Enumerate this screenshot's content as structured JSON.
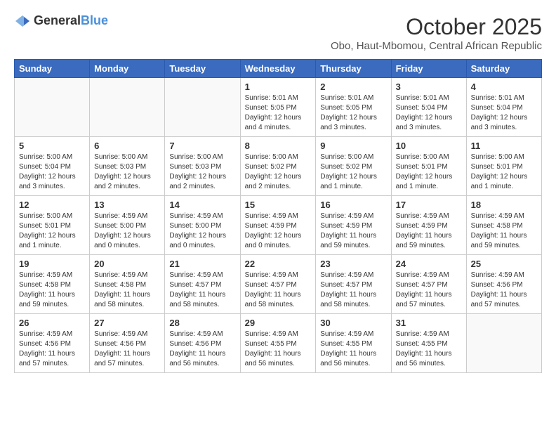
{
  "logo": {
    "general": "General",
    "blue": "Blue"
  },
  "header": {
    "month": "October 2025",
    "location": "Obo, Haut-Mbomou, Central African Republic"
  },
  "days_of_week": [
    "Sunday",
    "Monday",
    "Tuesday",
    "Wednesday",
    "Thursday",
    "Friday",
    "Saturday"
  ],
  "weeks": [
    [
      {
        "day": "",
        "info": ""
      },
      {
        "day": "",
        "info": ""
      },
      {
        "day": "",
        "info": ""
      },
      {
        "day": "1",
        "info": "Sunrise: 5:01 AM\nSunset: 5:05 PM\nDaylight: 12 hours\nand 4 minutes."
      },
      {
        "day": "2",
        "info": "Sunrise: 5:01 AM\nSunset: 5:05 PM\nDaylight: 12 hours\nand 3 minutes."
      },
      {
        "day": "3",
        "info": "Sunrise: 5:01 AM\nSunset: 5:04 PM\nDaylight: 12 hours\nand 3 minutes."
      },
      {
        "day": "4",
        "info": "Sunrise: 5:01 AM\nSunset: 5:04 PM\nDaylight: 12 hours\nand 3 minutes."
      }
    ],
    [
      {
        "day": "5",
        "info": "Sunrise: 5:00 AM\nSunset: 5:04 PM\nDaylight: 12 hours\nand 3 minutes."
      },
      {
        "day": "6",
        "info": "Sunrise: 5:00 AM\nSunset: 5:03 PM\nDaylight: 12 hours\nand 2 minutes."
      },
      {
        "day": "7",
        "info": "Sunrise: 5:00 AM\nSunset: 5:03 PM\nDaylight: 12 hours\nand 2 minutes."
      },
      {
        "day": "8",
        "info": "Sunrise: 5:00 AM\nSunset: 5:02 PM\nDaylight: 12 hours\nand 2 minutes."
      },
      {
        "day": "9",
        "info": "Sunrise: 5:00 AM\nSunset: 5:02 PM\nDaylight: 12 hours\nand 1 minute."
      },
      {
        "day": "10",
        "info": "Sunrise: 5:00 AM\nSunset: 5:01 PM\nDaylight: 12 hours\nand 1 minute."
      },
      {
        "day": "11",
        "info": "Sunrise: 5:00 AM\nSunset: 5:01 PM\nDaylight: 12 hours\nand 1 minute."
      }
    ],
    [
      {
        "day": "12",
        "info": "Sunrise: 5:00 AM\nSunset: 5:01 PM\nDaylight: 12 hours\nand 1 minute."
      },
      {
        "day": "13",
        "info": "Sunrise: 4:59 AM\nSunset: 5:00 PM\nDaylight: 12 hours\nand 0 minutes."
      },
      {
        "day": "14",
        "info": "Sunrise: 4:59 AM\nSunset: 5:00 PM\nDaylight: 12 hours\nand 0 minutes."
      },
      {
        "day": "15",
        "info": "Sunrise: 4:59 AM\nSunset: 4:59 PM\nDaylight: 12 hours\nand 0 minutes."
      },
      {
        "day": "16",
        "info": "Sunrise: 4:59 AM\nSunset: 4:59 PM\nDaylight: 11 hours\nand 59 minutes."
      },
      {
        "day": "17",
        "info": "Sunrise: 4:59 AM\nSunset: 4:59 PM\nDaylight: 11 hours\nand 59 minutes."
      },
      {
        "day": "18",
        "info": "Sunrise: 4:59 AM\nSunset: 4:58 PM\nDaylight: 11 hours\nand 59 minutes."
      }
    ],
    [
      {
        "day": "19",
        "info": "Sunrise: 4:59 AM\nSunset: 4:58 PM\nDaylight: 11 hours\nand 59 minutes."
      },
      {
        "day": "20",
        "info": "Sunrise: 4:59 AM\nSunset: 4:58 PM\nDaylight: 11 hours\nand 58 minutes."
      },
      {
        "day": "21",
        "info": "Sunrise: 4:59 AM\nSunset: 4:57 PM\nDaylight: 11 hours\nand 58 minutes."
      },
      {
        "day": "22",
        "info": "Sunrise: 4:59 AM\nSunset: 4:57 PM\nDaylight: 11 hours\nand 58 minutes."
      },
      {
        "day": "23",
        "info": "Sunrise: 4:59 AM\nSunset: 4:57 PM\nDaylight: 11 hours\nand 58 minutes."
      },
      {
        "day": "24",
        "info": "Sunrise: 4:59 AM\nSunset: 4:57 PM\nDaylight: 11 hours\nand 57 minutes."
      },
      {
        "day": "25",
        "info": "Sunrise: 4:59 AM\nSunset: 4:56 PM\nDaylight: 11 hours\nand 57 minutes."
      }
    ],
    [
      {
        "day": "26",
        "info": "Sunrise: 4:59 AM\nSunset: 4:56 PM\nDaylight: 11 hours\nand 57 minutes."
      },
      {
        "day": "27",
        "info": "Sunrise: 4:59 AM\nSunset: 4:56 PM\nDaylight: 11 hours\nand 57 minutes."
      },
      {
        "day": "28",
        "info": "Sunrise: 4:59 AM\nSunset: 4:56 PM\nDaylight: 11 hours\nand 56 minutes."
      },
      {
        "day": "29",
        "info": "Sunrise: 4:59 AM\nSunset: 4:55 PM\nDaylight: 11 hours\nand 56 minutes."
      },
      {
        "day": "30",
        "info": "Sunrise: 4:59 AM\nSunset: 4:55 PM\nDaylight: 11 hours\nand 56 minutes."
      },
      {
        "day": "31",
        "info": "Sunrise: 4:59 AM\nSunset: 4:55 PM\nDaylight: 11 hours\nand 56 minutes."
      },
      {
        "day": "",
        "info": ""
      }
    ]
  ]
}
